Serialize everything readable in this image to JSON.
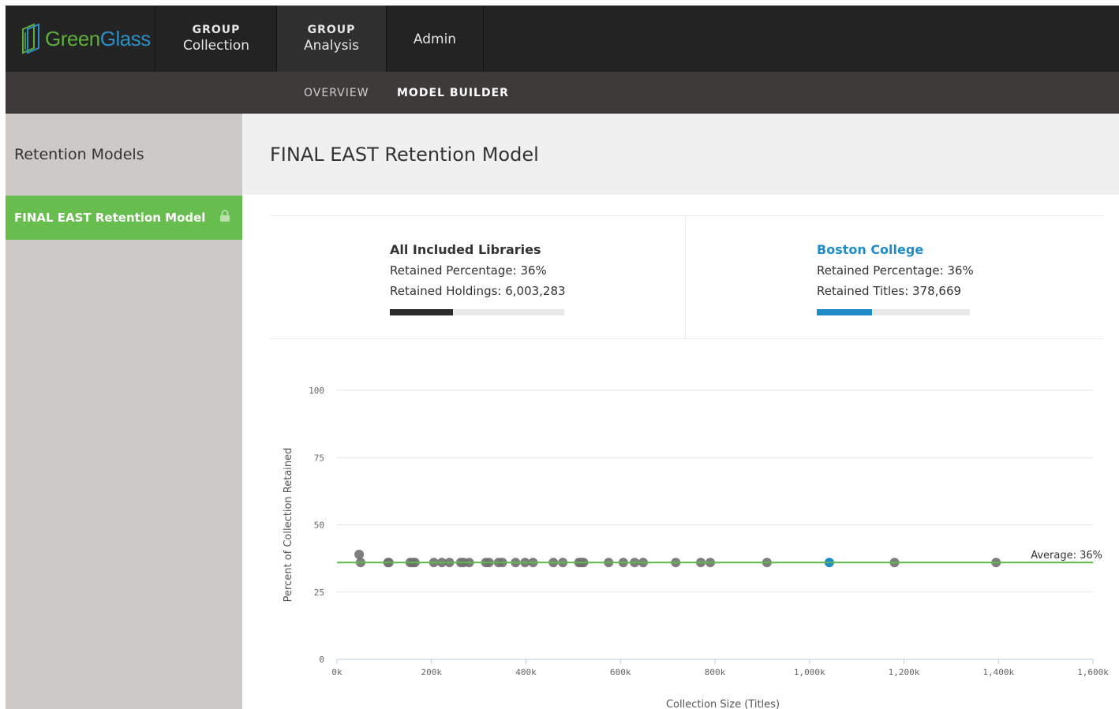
{
  "app": {
    "logo": {
      "part1": "Green",
      "part2": "Glass",
      "icon": "glass-logo-icon"
    },
    "nav": [
      {
        "sup": "GROUP",
        "label": "Collection"
      },
      {
        "sup": "GROUP",
        "label": "Analysis"
      },
      {
        "sup": "",
        "label": "Admin"
      }
    ],
    "subnav": {
      "overview": "OVERVIEW",
      "builder": "MODEL BUILDER"
    }
  },
  "sidebar": {
    "title": "Retention Models",
    "items": [
      {
        "label": "FINAL EAST Retention Model",
        "icon": "lock-icon"
      }
    ]
  },
  "main": {
    "title": "FINAL EAST Retention Model",
    "all": {
      "title": "All Included Libraries",
      "pct_label": "Retained Percentage: 36%",
      "count_label": "Retained Holdings: 6,003,283",
      "fraction": 0.36,
      "color": "#2b2b2b"
    },
    "library": {
      "title": "Boston College",
      "pct_label": "Retained Percentage: 36%",
      "count_label": "Retained Titles: 378,669",
      "fraction": 0.36,
      "color": "#1f8cc8"
    }
  },
  "chart_data": {
    "type": "scatter",
    "xlabel": "Collection Size (Titles)",
    "ylabel": "Percent of Collection Retained",
    "xlim": [
      0,
      1600000
    ],
    "ylim": [
      0,
      100
    ],
    "x_ticks": [
      "0k",
      "200k",
      "400k",
      "600k",
      "800k",
      "1,000k",
      "1,200k",
      "1,400k",
      "1,600k"
    ],
    "x_tick_values": [
      0,
      200000,
      400000,
      600000,
      800000,
      1000000,
      1200000,
      1400000,
      1600000
    ],
    "y_ticks": [
      0,
      25,
      50,
      75,
      100
    ],
    "average": {
      "value": 36,
      "label": "Average: 36%",
      "color": "#5fb84a"
    },
    "grid": "horizontal",
    "point_color": "#707070",
    "highlight_color": "#1f8cc8",
    "series": [
      {
        "points": [
          [
            47000,
            39
          ],
          [
            50000,
            36
          ],
          [
            108000,
            36
          ],
          [
            110000,
            36
          ],
          [
            155000,
            36
          ],
          [
            160000,
            36
          ],
          [
            165000,
            36
          ],
          [
            205000,
            36
          ],
          [
            222000,
            36
          ],
          [
            238000,
            36
          ],
          [
            262000,
            36
          ],
          [
            268000,
            36
          ],
          [
            280000,
            36
          ],
          [
            315000,
            36
          ],
          [
            322000,
            36
          ],
          [
            342000,
            36
          ],
          [
            350000,
            36
          ],
          [
            378000,
            36
          ],
          [
            398000,
            36
          ],
          [
            415000,
            36
          ],
          [
            458000,
            36
          ],
          [
            478000,
            36
          ],
          [
            512000,
            36
          ],
          [
            517000,
            36
          ],
          [
            522000,
            36
          ],
          [
            575000,
            36
          ],
          [
            606000,
            36
          ],
          [
            630000,
            36
          ],
          [
            648000,
            36
          ],
          [
            717000,
            36
          ],
          [
            770000,
            36
          ],
          [
            790000,
            36
          ],
          [
            910000,
            36
          ],
          [
            1180000,
            36
          ],
          [
            1395000,
            36
          ]
        ]
      },
      {
        "name": "Boston College",
        "highlight": true,
        "points": [
          [
            1042000,
            36
          ]
        ]
      }
    ]
  }
}
